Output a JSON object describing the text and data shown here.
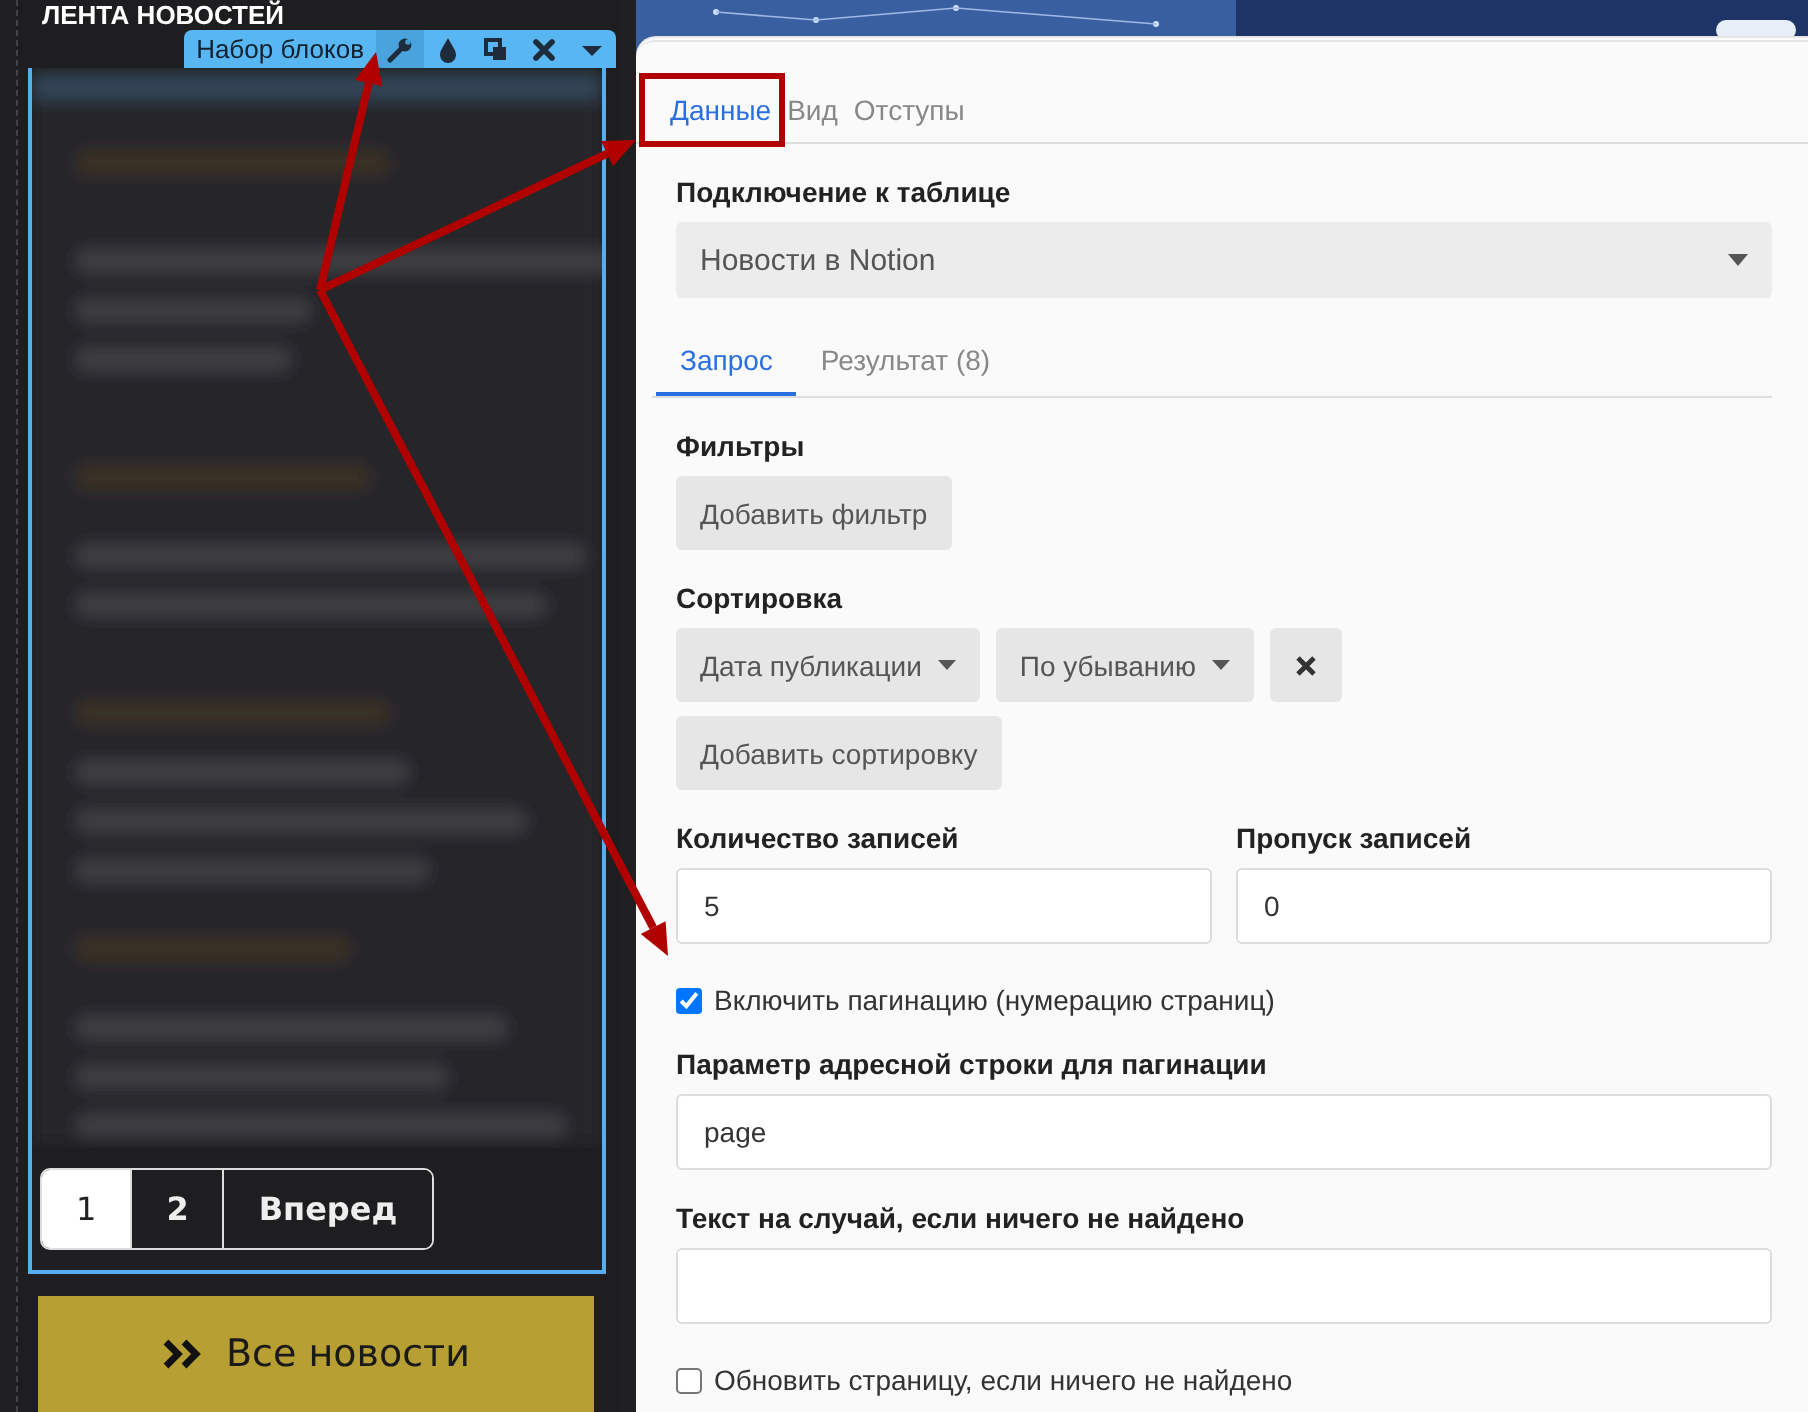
{
  "left_block": {
    "title": "ЛЕНТА НОВОСТЕЙ",
    "toolbar": {
      "label": "Набор блоков"
    },
    "pagination": [
      {
        "label": "1",
        "selected": true
      },
      {
        "label": "2",
        "selected": false
      },
      {
        "label": "Вперед",
        "selected": false
      }
    ],
    "all_news_button": "Все новости"
  },
  "settings": {
    "tabs": [
      {
        "label": "Данные",
        "selected": true
      },
      {
        "label": "Вид",
        "selected": false
      },
      {
        "label": "Отступы",
        "selected": false
      }
    ],
    "table_connection": {
      "label": "Подключение к таблице",
      "value": "Новости в Notion"
    },
    "subtabs": [
      {
        "label": "Запрос",
        "selected": true
      },
      {
        "label": "Результат (8)",
        "selected": false
      }
    ],
    "filters": {
      "label": "Фильтры",
      "add_button": "Добавить фильтр"
    },
    "sorting": {
      "label": "Сортировка",
      "field": "Дата публикации",
      "order": "По убыванию",
      "add_button": "Добавить сортировку"
    },
    "record_count": {
      "label": "Количество записей",
      "value": "5"
    },
    "record_skip": {
      "label": "Пропуск записей",
      "value": "0"
    },
    "pagination_enabled": {
      "label": "Включить пагинацию (нумерацию страниц)",
      "checked": true
    },
    "url_param": {
      "label": "Параметр адресной строки для пагинации",
      "value": "page"
    },
    "not_found_text": {
      "label": "Текст на случай, если ничего не найдено"
    },
    "refresh_if_empty": {
      "label": "Обновить страницу, если ничего не найдено",
      "checked": false
    }
  }
}
